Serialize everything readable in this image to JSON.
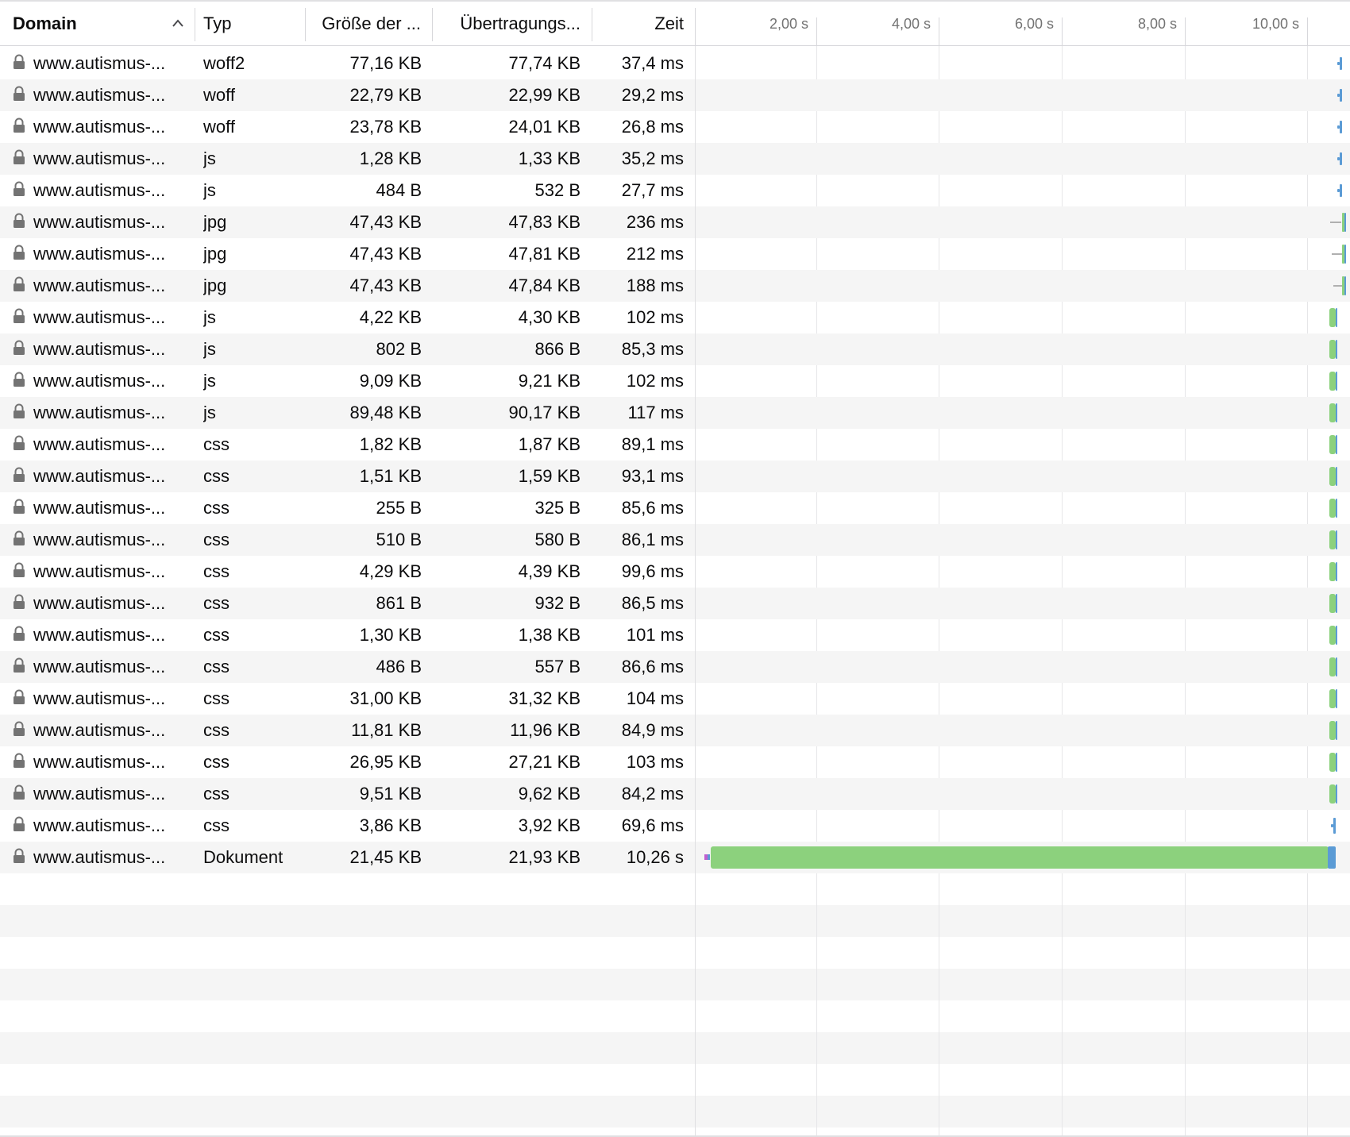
{
  "header": {
    "columns": {
      "domain": "Domain",
      "type": "Typ",
      "size": "Größe der ...",
      "transfer": "Übertragungs...",
      "time": "Zeit"
    },
    "ticks": [
      "2,00 s",
      "4,00 s",
      "6,00 s",
      "8,00 s",
      "10,00 s"
    ],
    "sort_icon": "chevron-up-icon"
  },
  "rows": [
    {
      "domain": "www.autismus-...",
      "type": "woff2",
      "size": "77,16 KB",
      "transfer": "77,74 KB",
      "time": "37,4 ms"
    },
    {
      "domain": "www.autismus-...",
      "type": "woff",
      "size": "22,79 KB",
      "transfer": "22,99 KB",
      "time": "29,2 ms"
    },
    {
      "domain": "www.autismus-...",
      "type": "woff",
      "size": "23,78 KB",
      "transfer": "24,01 KB",
      "time": "26,8 ms"
    },
    {
      "domain": "www.autismus-...",
      "type": "js",
      "size": "1,28 KB",
      "transfer": "1,33 KB",
      "time": "35,2 ms"
    },
    {
      "domain": "www.autismus-...",
      "type": "js",
      "size": "484 B",
      "transfer": "532 B",
      "time": "27,7 ms"
    },
    {
      "domain": "www.autismus-...",
      "type": "jpg",
      "size": "47,43 KB",
      "transfer": "47,83 KB",
      "time": "236 ms"
    },
    {
      "domain": "www.autismus-...",
      "type": "jpg",
      "size": "47,43 KB",
      "transfer": "47,81 KB",
      "time": "212 ms"
    },
    {
      "domain": "www.autismus-...",
      "type": "jpg",
      "size": "47,43 KB",
      "transfer": "47,84 KB",
      "time": "188 ms"
    },
    {
      "domain": "www.autismus-...",
      "type": "js",
      "size": "4,22 KB",
      "transfer": "4,30 KB",
      "time": "102 ms"
    },
    {
      "domain": "www.autismus-...",
      "type": "js",
      "size": "802 B",
      "transfer": "866 B",
      "time": "85,3 ms"
    },
    {
      "domain": "www.autismus-...",
      "type": "js",
      "size": "9,09 KB",
      "transfer": "9,21 KB",
      "time": "102 ms"
    },
    {
      "domain": "www.autismus-...",
      "type": "js",
      "size": "89,48 KB",
      "transfer": "90,17 KB",
      "time": "117 ms"
    },
    {
      "domain": "www.autismus-...",
      "type": "css",
      "size": "1,82 KB",
      "transfer": "1,87 KB",
      "time": "89,1 ms"
    },
    {
      "domain": "www.autismus-...",
      "type": "css",
      "size": "1,51 KB",
      "transfer": "1,59 KB",
      "time": "93,1 ms"
    },
    {
      "domain": "www.autismus-...",
      "type": "css",
      "size": "255 B",
      "transfer": "325 B",
      "time": "85,6 ms"
    },
    {
      "domain": "www.autismus-...",
      "type": "css",
      "size": "510 B",
      "transfer": "580 B",
      "time": "86,1 ms"
    },
    {
      "domain": "www.autismus-...",
      "type": "css",
      "size": "4,29 KB",
      "transfer": "4,39 KB",
      "time": "99,6 ms"
    },
    {
      "domain": "www.autismus-...",
      "type": "css",
      "size": "861 B",
      "transfer": "932 B",
      "time": "86,5 ms"
    },
    {
      "domain": "www.autismus-...",
      "type": "css",
      "size": "1,30 KB",
      "transfer": "1,38 KB",
      "time": "101 ms"
    },
    {
      "domain": "www.autismus-...",
      "type": "css",
      "size": "486 B",
      "transfer": "557 B",
      "time": "86,6 ms"
    },
    {
      "domain": "www.autismus-...",
      "type": "css",
      "size": "31,00 KB",
      "transfer": "31,32 KB",
      "time": "104 ms"
    },
    {
      "domain": "www.autismus-...",
      "type": "css",
      "size": "11,81 KB",
      "transfer": "11,96 KB",
      "time": "84,9 ms"
    },
    {
      "domain": "www.autismus-...",
      "type": "css",
      "size": "26,95 KB",
      "transfer": "27,21 KB",
      "time": "103 ms"
    },
    {
      "domain": "www.autismus-...",
      "type": "css",
      "size": "9,51 KB",
      "transfer": "9,62 KB",
      "time": "84,2 ms"
    },
    {
      "domain": "www.autismus-...",
      "type": "css",
      "size": "3,86 KB",
      "transfer": "3,92 KB",
      "time": "69,6 ms"
    },
    {
      "domain": "www.autismus-...",
      "type": "Dokument",
      "size": "21,45 KB",
      "transfer": "21,93 KB",
      "time": "10,26 s"
    }
  ],
  "colors": {
    "receive": "#8cd17d",
    "wait": "#5b9bd5",
    "blocked": "#b0b0b0",
    "dns": "#c060d0",
    "stripe": "#f5f5f5",
    "lock": "#737373"
  },
  "icons": {
    "secure": "lock-icon"
  }
}
